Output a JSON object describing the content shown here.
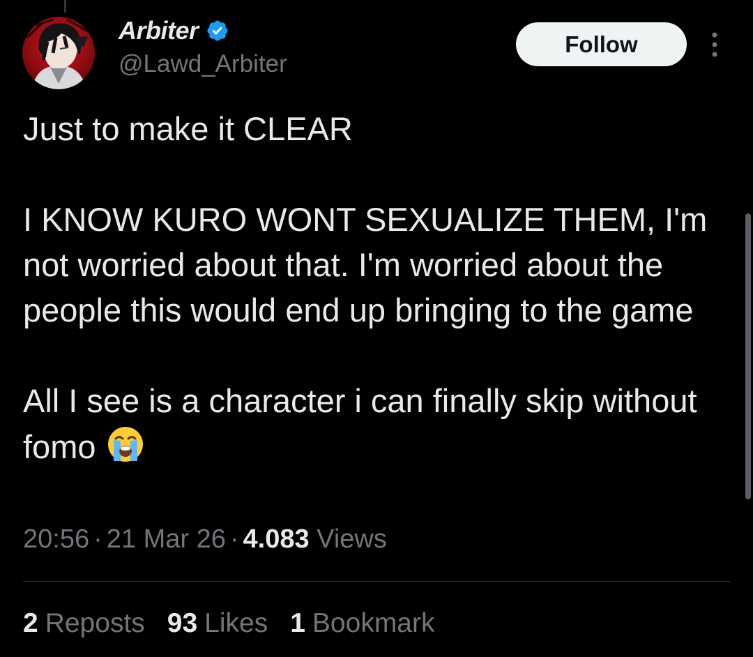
{
  "author": {
    "display_name": "Arbiter",
    "handle": "@Lawd_Arbiter",
    "verified_icon": "verified-badge-icon",
    "avatar_icon": "avatar-image"
  },
  "actions": {
    "follow_label": "Follow",
    "more_icon": "more-vertical-icon"
  },
  "tweet": {
    "text_paragraph_1": "Just to make it CLEAR",
    "text_paragraph_2": "I KNOW KURO WONT SEXUALIZE THEM, I'm not worried about that. I'm worried about the people this would end up bringing to the game",
    "text_paragraph_3": "All I see is a character i can finally skip without fomo",
    "emoji_icon": "loudly-crying-face-icon"
  },
  "meta": {
    "time": "20:56",
    "date": "21 Mar 26",
    "separator": "·",
    "views_count": "4.083",
    "views_label": "Views"
  },
  "stats": {
    "reposts_count": "2",
    "reposts_label": "Reposts",
    "likes_count": "93",
    "likes_label": "Likes",
    "bookmarks_count": "1",
    "bookmarks_label": "Bookmark"
  },
  "colors": {
    "background": "#000000",
    "primary_text": "#e7e9ea",
    "secondary_text": "#71767b",
    "verified_blue": "#1d9bf0",
    "follow_button_bg": "#eff3f4",
    "divider": "#2f3336"
  }
}
